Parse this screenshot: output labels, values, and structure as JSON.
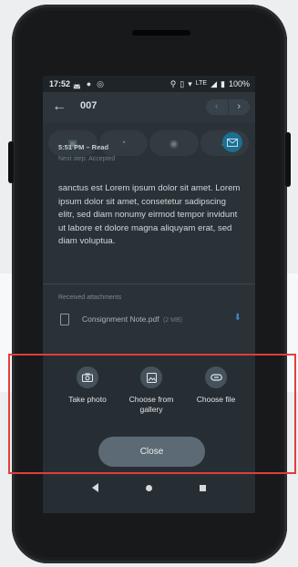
{
  "status_bar": {
    "time": "17:52",
    "battery": "100%",
    "network": "LTE"
  },
  "app_bar": {
    "title": "007",
    "back_symbol": "←",
    "prev_symbol": "‹",
    "next_symbol": "›"
  },
  "message": {
    "time_status": "5:51 PM – Read",
    "next_step": "Next step: Accepted",
    "body": "sanctus est Lorem ipsum dolor sit amet. Lorem ipsum dolor sit amet, consetetur sadipscing elitr, sed diam nonumy eirmod tempor invidunt ut labore et dolore magna aliquyam erat, sed diam voluptua."
  },
  "attachments": {
    "label": "Received attachments",
    "items": [
      {
        "name": "Consignment Note.pdf",
        "size": "(2 MB)"
      }
    ]
  },
  "sheet": {
    "options": [
      {
        "label": "Take photo",
        "icon": "camera-icon"
      },
      {
        "label": "Choose from gallery",
        "icon": "gallery-icon"
      },
      {
        "label": "Choose file",
        "icon": "attach-icon"
      }
    ],
    "close_label": "Close"
  },
  "colors": {
    "highlight_box": "#e23d3d",
    "mail_button": "#1d6f92",
    "screen_bg": "#2b3237"
  }
}
